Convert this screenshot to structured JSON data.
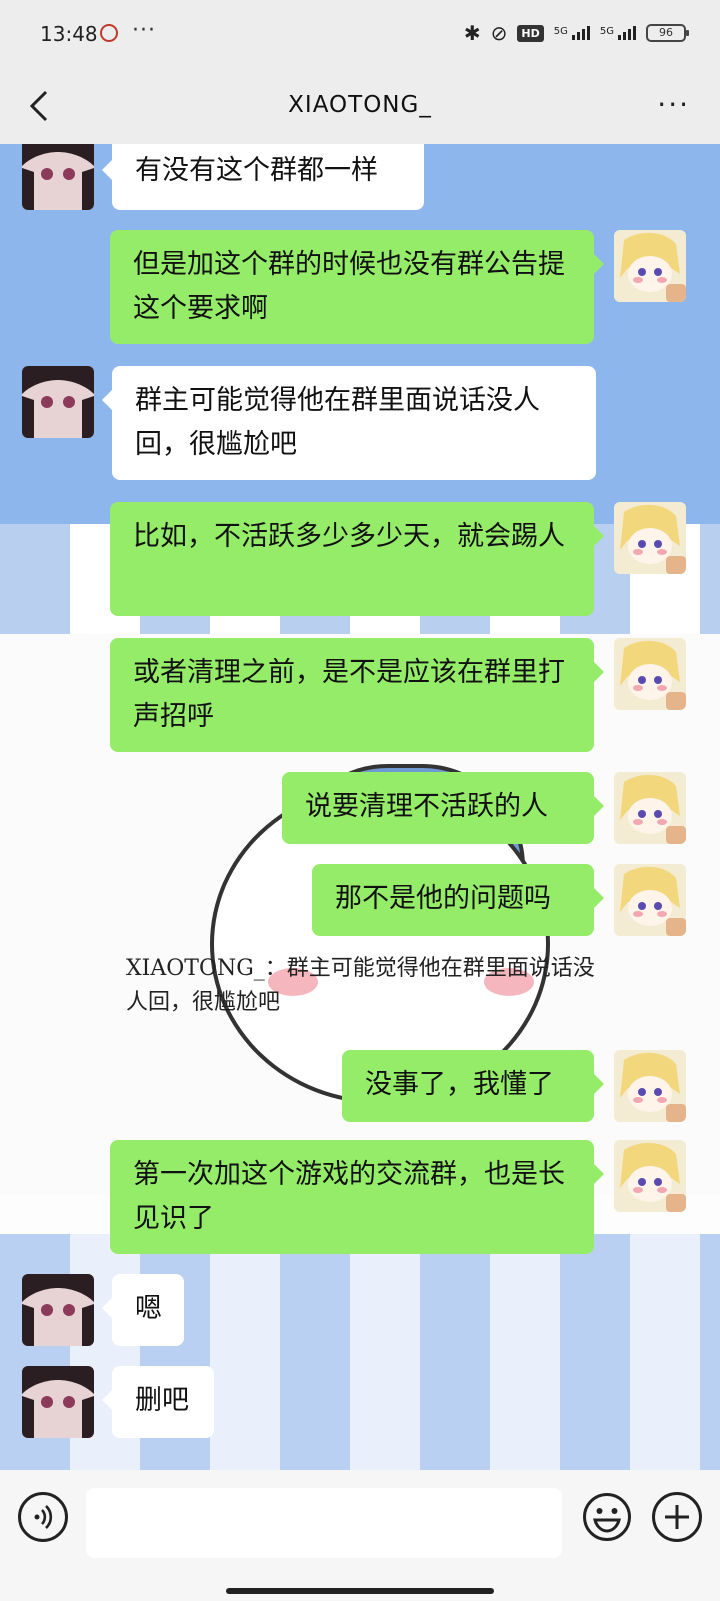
{
  "status_bar": {
    "time": "13:48",
    "dots": "···",
    "hd_label": "HD",
    "net1": "5G",
    "net2": "5G",
    "battery": "96"
  },
  "header": {
    "title": "XIAOTONG_",
    "more": "···"
  },
  "messages": [
    {
      "side": "left",
      "text": "有没有这个群都一样"
    },
    {
      "side": "right",
      "text": "但是加这个群的时候也没有群公告提这个要求啊"
    },
    {
      "side": "left",
      "text": "群主可能觉得他在群里面说话没人回，很尴尬吧"
    },
    {
      "side": "right",
      "text": "比如，不活跃多少多少天，就会踢人"
    },
    {
      "side": "right",
      "text": "或者清理之前，是不是应该在群里打声招呼"
    },
    {
      "side": "right",
      "text": "说要清理不活跃的人"
    },
    {
      "side": "right",
      "text": "那不是他的问题吗"
    },
    {
      "side": "quote",
      "text": "XIAOTONG_：群主可能觉得他在群里面说话没人回，很尴尬吧"
    },
    {
      "side": "right",
      "text": "没事了，我懂了"
    },
    {
      "side": "right",
      "text": "第一次加这个游戏的交流群，也是长见识了"
    },
    {
      "side": "left",
      "text": "嗯"
    },
    {
      "side": "left",
      "text": "删吧"
    }
  ],
  "icons": {
    "back": "back-arrow-icon",
    "more": "more-icon",
    "voice": "voice-icon",
    "emoji": "emoji-icon",
    "plus": "plus-icon"
  },
  "colors": {
    "bubble_self": "#95ec69",
    "bubble_other": "#ffffff",
    "wallpaper_blue": "#8db6ec"
  }
}
